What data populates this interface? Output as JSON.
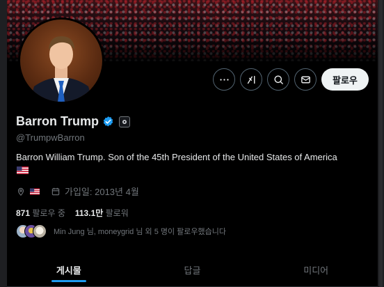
{
  "profile": {
    "display_name": "Barron Trump",
    "handle": "@TrumpwBarron",
    "bio": "Barron William Trump. Son of the 45th President of the United States of America",
    "bio_flag": "us-flag-emoji",
    "location_flag": "us-flag-emoji",
    "joined": "가입일: 2013년 4월"
  },
  "actions": {
    "more_icon": "more-icon",
    "grok_icon": "grok-icon",
    "search_icon": "search-icon",
    "message_icon": "message-icon",
    "follow_label": "팔로우"
  },
  "stats": {
    "following_count": "871",
    "following_label": "팔로우 중",
    "followers_count": "113.1만",
    "followers_label": "팔로워"
  },
  "followers_you_know": "Min Jung 님, moneygrid 님 외 5 명이 팔로우했습니다",
  "tabs": [
    {
      "label": "게시물",
      "active": true
    },
    {
      "label": "답글",
      "active": false
    },
    {
      "label": "미디어",
      "active": false
    }
  ],
  "colors": {
    "accent": "#1d9bf0",
    "background": "#000000",
    "text_primary": "#e7e9ea",
    "text_secondary": "#71767b"
  }
}
